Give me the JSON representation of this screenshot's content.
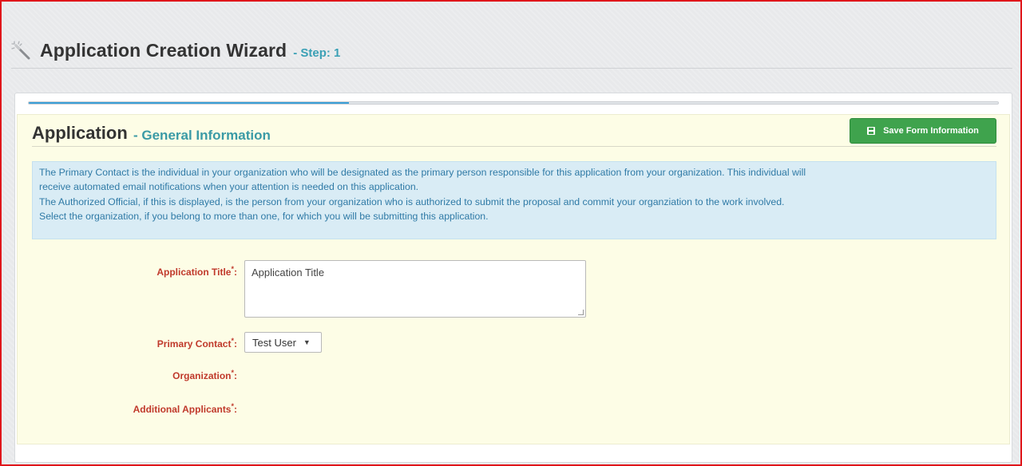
{
  "header": {
    "title": "Application Creation Wizard",
    "step": "- Step: 1",
    "icon": "magic-wand-icon"
  },
  "progress": {
    "fraction": 0.33
  },
  "section": {
    "title": "Application",
    "subtitle": "- General Information",
    "save_button": {
      "label": "Save Form Information",
      "icon": "floppy-disk-icon",
      "color": "#3fa34d"
    }
  },
  "info": {
    "line1": "The Primary Contact is the individual in your organization who will be designated as the primary person responsible for this application from your organization. This individual will",
    "line2": "receive automated email notifications when your attention is needed on this application.",
    "line3": "The Authorized Official, if this is displayed, is the person from your organization who is authorized to submit the proposal and commit your organziation to the work involved.",
    "line4": "Select the organization, if you belong to more than one, for which you will be submitting this application."
  },
  "form": {
    "application_title": {
      "label": "Application Title",
      "value": "Application Title"
    },
    "primary_contact": {
      "label": "Primary Contact",
      "value": "Test User"
    },
    "organization": {
      "label": "Organization"
    },
    "additional_applicants": {
      "label": "Additional Applicants"
    },
    "required_mark": "*",
    "colon": ":"
  },
  "colors": {
    "accent": "#3a9aa6",
    "required": "#c0392b",
    "info_text": "#2f7aa6",
    "frame_border": "#e0161b"
  }
}
